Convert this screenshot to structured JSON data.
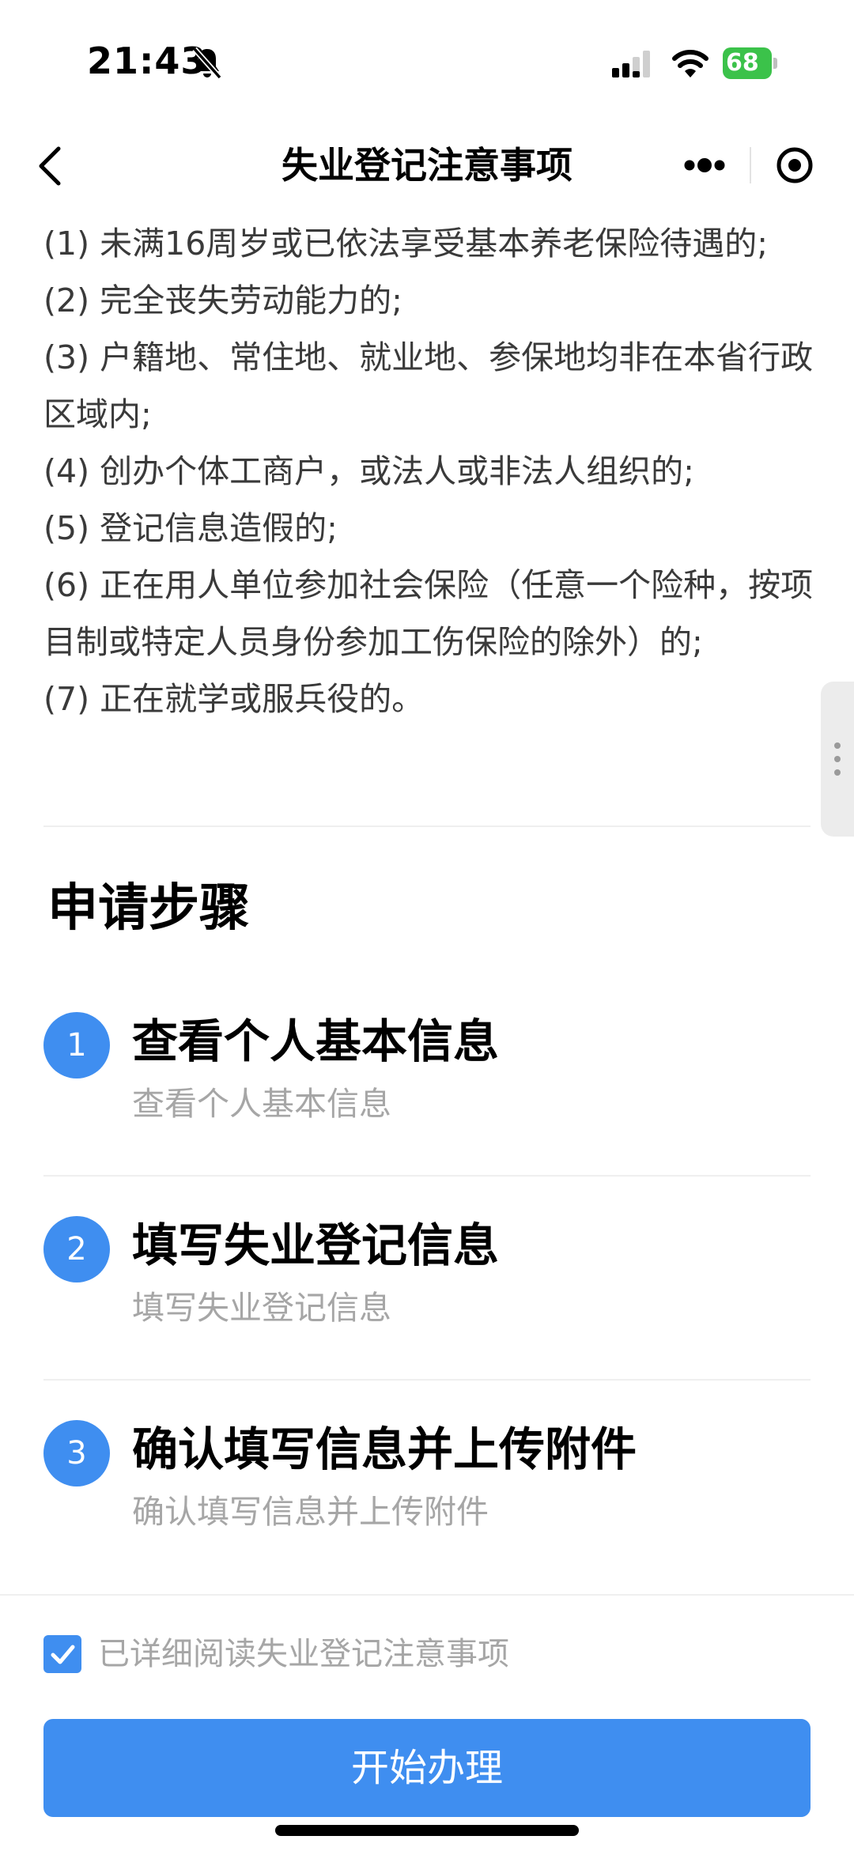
{
  "status_bar": {
    "time": "21:43",
    "battery_level": "68"
  },
  "nav": {
    "title": "失业登记注意事项"
  },
  "conditions": [
    "(1) 未满16周岁或已依法享受基本养老保险待遇的;",
    "(2) 完全丧失劳动能力的;",
    "(3) 户籍地、常住地、就业地、参保地均非在本省行政区域内;",
    "(4) 创办个体工商户，或法人或非法人组织的;",
    "(5) 登记信息造假的;",
    "(6) 正在用人单位参加社会保险（任意一个险种，按项目制或特定人员身份参加工伤保险的除外）的;",
    "(7) 正在就学或服兵役的。"
  ],
  "steps_section": {
    "title": "申请步骤",
    "steps": [
      {
        "number": "1",
        "title": "查看个人基本信息",
        "subtitle": "查看个人基本信息"
      },
      {
        "number": "2",
        "title": "填写失业登记信息",
        "subtitle": "填写失业登记信息"
      },
      {
        "number": "3",
        "title": "确认填写信息并上传附件",
        "subtitle": "确认填写信息并上传附件"
      }
    ]
  },
  "agreement": {
    "label": "已详细阅读失业登记注意事项",
    "checked": true
  },
  "actions": {
    "start_label": "开始办理"
  },
  "colors": {
    "accent": "#3f8ef0",
    "battery": "#3bc24a",
    "muted_text": "#a6a6a6",
    "body_text": "#3a3a3a"
  },
  "icons": {
    "bell": "bell-slash-icon",
    "signal": "cellular-signal-icon",
    "wifi": "wifi-icon",
    "back": "chevron-left-icon",
    "more": "more-dots-icon",
    "target": "target-circle-icon",
    "checkbox": "checkmark-icon",
    "side": "vertical-dots-icon"
  }
}
